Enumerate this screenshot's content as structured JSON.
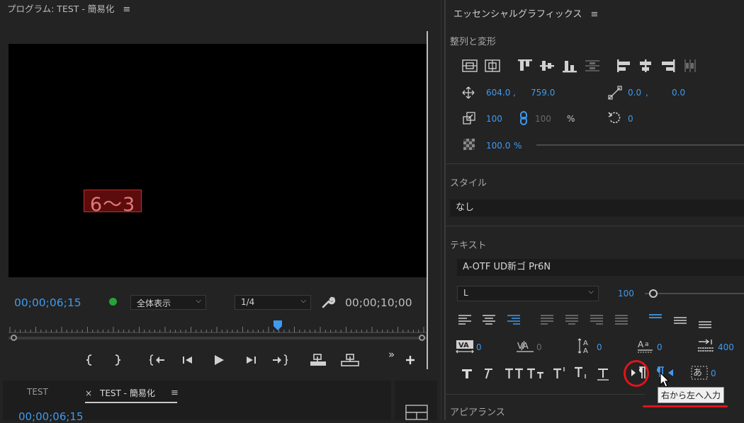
{
  "program": {
    "title": "プログラム: TEST - 簡易化",
    "menu_glyph": "≡",
    "caption_text": "6〜3",
    "timecode_current": "00;00;06;15",
    "zoom_label": "全体表示",
    "resolution_label": "1/4",
    "timecode_duration": "00;00;10;00"
  },
  "timeline": {
    "tabs": [
      {
        "label": "TEST"
      },
      {
        "label": "TEST - 簡易化",
        "close": "×"
      }
    ],
    "timecode": "00;00;06;15"
  },
  "essential_graphics": {
    "title": "エッセンシャルグラフィックス",
    "align_section": "整列と変形",
    "position": {
      "x": "604.0",
      "sep": ",",
      "y": "759.0"
    },
    "anchor": {
      "x": "0.0",
      "sep": ",",
      "y": "0.0"
    },
    "scale": {
      "value": "100",
      "linked": "100",
      "unit": "%"
    },
    "rotation": "0",
    "opacity": {
      "value": "100.0",
      "unit": "%"
    },
    "style_section": "スタイル",
    "style_value": "なし",
    "text_section": "テキスト",
    "font_name": "A-OTF UD新ゴ Pr6N",
    "font_style": "L",
    "font_size": "100",
    "tracking_value": "0",
    "kerning_value": "0",
    "leading_value": "0",
    "baseline_value": "0",
    "tab_width": "400",
    "tsume_value": "0",
    "appearance_section": "アピアランス",
    "tooltip": "右から左へ入力"
  },
  "colors": {
    "accent": "#3f9af0",
    "highlight_red": "#e0141a",
    "caption_red": "#c0302c"
  }
}
